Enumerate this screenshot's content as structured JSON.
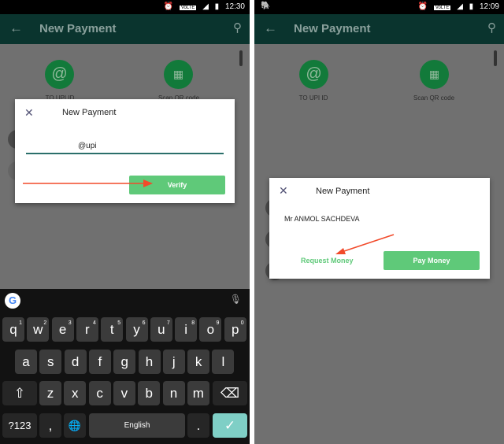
{
  "left": {
    "status": {
      "time": "12:30",
      "network": "VoLTE",
      "signal": "4G"
    },
    "toolbar": {
      "title": "New Payment"
    },
    "options": [
      {
        "label": "TO UPI ID",
        "icon": "at-icon"
      },
      {
        "label": "Scan QR code",
        "icon": "qr-icon"
      }
    ],
    "dialog": {
      "title": "New Payment",
      "input_value": "@upi",
      "verify_label": "Verify"
    },
    "keyboard": {
      "rows": [
        [
          "q",
          "w",
          "e",
          "r",
          "t",
          "y",
          "u",
          "i",
          "o",
          "p"
        ],
        [
          "a",
          "s",
          "d",
          "f",
          "g",
          "h",
          "j",
          "k",
          "l"
        ],
        [
          "z",
          "x",
          "c",
          "v",
          "b",
          "n",
          "m"
        ]
      ],
      "hints": [
        "1",
        "2",
        "3",
        "4",
        "5",
        "6",
        "7",
        "8",
        "9",
        "0"
      ],
      "symbols_label": "?123",
      "space_label": "English",
      "period_label": ".",
      "comma_label": ","
    }
  },
  "right": {
    "status": {
      "time": "12:09",
      "network": "VoLTE",
      "signal": "4G"
    },
    "toolbar": {
      "title": "New Payment"
    },
    "options": [
      {
        "label": "TO UPI ID",
        "icon": "at-icon"
      },
      {
        "label": "Scan QR code",
        "icon": "qr-icon"
      }
    ],
    "dialog": {
      "title": "New Payment",
      "payee_name": "Mr ANMOL SACHDEVA",
      "request_label": "Request Money",
      "pay_label": "Pay Money"
    }
  },
  "colors": {
    "accent": "#5fc979",
    "toolbar": "#0a342e",
    "arrow": "#f24a2a"
  }
}
